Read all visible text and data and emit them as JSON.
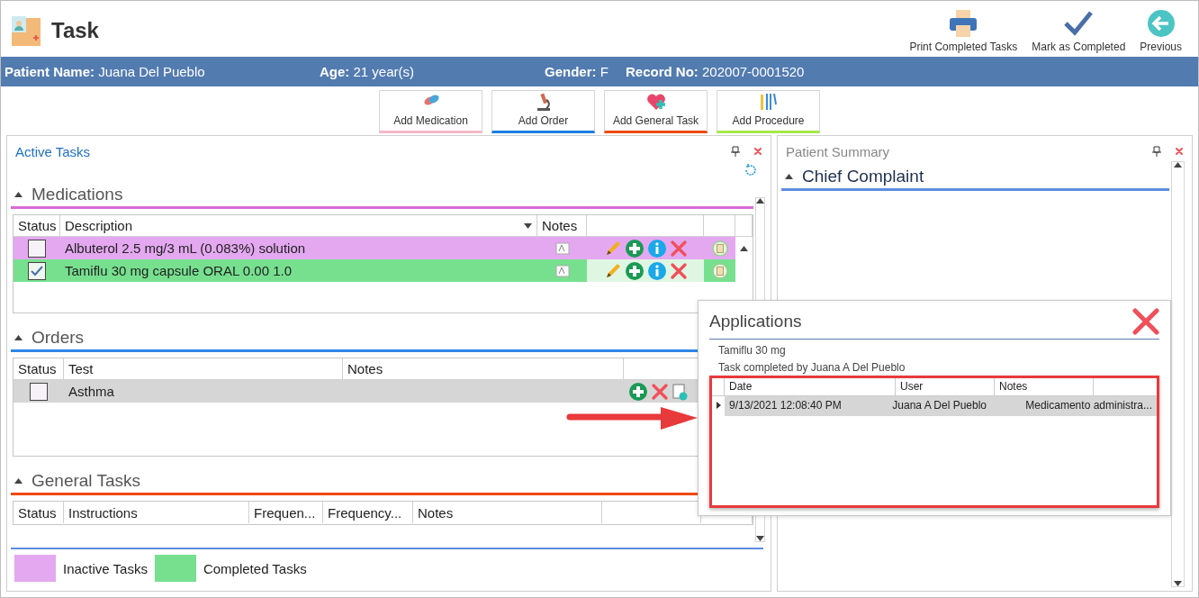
{
  "header": {
    "title": "Task",
    "actions": [
      {
        "kind": "print",
        "label": "Print Completed Tasks"
      },
      {
        "kind": "check",
        "label": "Mark as Completed"
      },
      {
        "kind": "back",
        "label": "Previous"
      }
    ]
  },
  "patient": [
    {
      "label": "Patient Name:",
      "value": "Juana Del Pueblo"
    },
    {
      "label": "Age:",
      "value": "21 year(s)"
    },
    {
      "label": "Gender:",
      "value": "F"
    },
    {
      "label": "Record No:",
      "value": "202007-0001520"
    }
  ],
  "add_buttons": [
    {
      "kind": "medication",
      "label": "Add Medication",
      "color": "#f4b8c8"
    },
    {
      "kind": "order",
      "label": "Add Order",
      "color": "#1e7ee0"
    },
    {
      "kind": "general",
      "label": "Add General Task",
      "color": "#f04a10"
    },
    {
      "kind": "procedure",
      "label": "Add Procedure",
      "color": "#a6e84a"
    }
  ],
  "active_tasks": {
    "title": "Active Tasks",
    "medications": {
      "title": "Medications",
      "color": "#d96ad8",
      "columns": [
        "Status",
        "Description",
        "Notes"
      ],
      "rows": [
        {
          "checked": false,
          "description": "Albuterol 2.5 mg/3 mL (0.083%) solution",
          "color": "#e4a8f0"
        },
        {
          "checked": true,
          "description": "Tamiflu 30 mg capsule ORAL 0.00 1.0",
          "color": "#77e08f"
        }
      ]
    },
    "orders": {
      "title": "Orders",
      "color": "#2f86e8",
      "columns": [
        "Status",
        "Test",
        "Notes"
      ],
      "rows": [
        {
          "checked": false,
          "test": "Asthma",
          "color": "#d6d6d6"
        }
      ]
    },
    "general_tasks": {
      "title": "General Tasks",
      "color": "#f04a10",
      "columns": [
        "Status",
        "Instructions",
        "Frequen...",
        "Frequency...",
        "Notes"
      ]
    }
  },
  "legend": [
    {
      "label": "Inactive Tasks",
      "color": "#e4a8f0"
    },
    {
      "label": "Completed Tasks",
      "color": "#77e08f"
    }
  ],
  "summary": {
    "title": "Patient Summary",
    "sections": [
      {
        "title": "Chief Complaint",
        "color": "#5b8de0"
      }
    ]
  },
  "popup": {
    "title": "Applications",
    "medication": "Tamiflu 30 mg",
    "completed_by": "Task completed by Juana A Del Pueblo",
    "columns": [
      "Date",
      "User",
      "Notes"
    ],
    "rows": [
      {
        "date": "9/13/2021 12:08:40 PM",
        "user": "Juana A Del Pueblo",
        "notes": "Medicamento administra...",
        "selected": true
      }
    ]
  }
}
